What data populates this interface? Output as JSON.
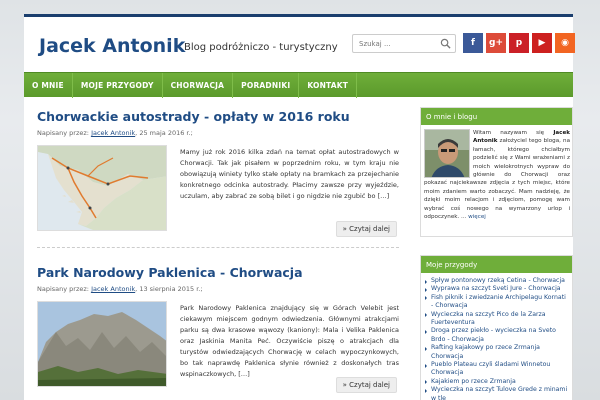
{
  "site": {
    "title": "Jacek Antonik",
    "description": "Blog podróżniczo - turystyczny"
  },
  "search": {
    "placeholder": "Szukaj ..."
  },
  "social": [
    {
      "name": "facebook-icon",
      "glyph": "f",
      "color": "#3b5998"
    },
    {
      "name": "google-plus-icon",
      "glyph": "g+",
      "color": "#dd4b39"
    },
    {
      "name": "pinterest-icon",
      "glyph": "p",
      "color": "#cb2027"
    },
    {
      "name": "youtube-icon",
      "glyph": "▶",
      "color": "#cd201f"
    },
    {
      "name": "rss-icon",
      "glyph": "◉",
      "color": "#f26522"
    }
  ],
  "nav": [
    "O MNIE",
    "MOJE PRZYGODY",
    "CHORWACJA",
    "PORADNIKI",
    "KONTAKT"
  ],
  "posts": [
    {
      "title": "Chorwackie autostrady - opłaty w 2016 roku",
      "meta_prefix": "Napisany przez:",
      "author": "Jacek Antonik",
      "date": "25 maja 2016 r.;",
      "excerpt": "Mamy już rok 2016 kilka zdań na temat opłat autostradowych w Chorwacji. Tak jak pisałem w poprzednim roku, w tym kraju nie obowiązują winiety tylko stałe opłaty na bramkach za przejechanie konkretnego odcinka autostrady. Płacimy zawsze przy wyjeździe, uczulam, aby zabrać ze sobą bilet i go nigdzie nie zgubić bo […]",
      "readmore": "» Czytaj dalej"
    },
    {
      "title": "Park Narodowy Paklenica - Chorwacja",
      "meta_prefix": "Napisany przez:",
      "author": "Jacek Antonik",
      "date": "13 sierpnia 2015 r.;",
      "excerpt": "Park Narodowy Paklenica znajdujący się w Górach Velebit jest ciekawym miejscem godnym odwiedzenia. Głównymi atrakcjami parku są dwa krasowe wąwozy (kaniony): Mala i Velika Paklenica oraz Jaskinia Manita Peć. Oczywiście piszę o atrakcjach dla turystów odwiedzających Chorwację w celach wypoczynkowych, bo tak naprawdę Paklenica słynie również z doskonałych tras wspinaczkowych, […]",
      "readmore": "» Czytaj dalej"
    }
  ],
  "sidebar": {
    "about_title": "O mnie i blogu",
    "about_lead": "Witam nazywam się",
    "about_name": "Jacek Antonik",
    "about_text": " założyciel tego bloga, na łamach, którego chciałbym podzielić się z Wami wrażeniami z moich wielokrotnych wypraw do głównie do Chorwacji oraz pokazać najciekawsze zdjęcia z tych miejsc, które moim zdaniem warto zobaczyć. Mam nadzieję, że dzięki moim relacjom i zdjęciom, pomogę wam wybrać coś nowego na wymarzony urlop i odpoczynek. ...",
    "about_more": "więcej",
    "trips_title": "Moje przygody",
    "trips": [
      "Spływ pontonowy rzeką Cetina - Chorwacja",
      "Wyprawa na szczyt Sveti Jure - Chorwacja",
      "Fish piknik i zwiedzanie Archipelagu Kornati - Chorwacja",
      "Wycieczka na szczyt Pico de la Zarza Fuerteventura",
      "Droga przez piekło - wycieczka na Sveto Brdo - Chorwacja",
      "Rafting kajakowy po rzece Zrmanja Chorwacja",
      "Pueblo Plateau czyli śladami Winnetou Chorwacja",
      "Kajakiem po rzece Zrmanja",
      "Wycieczka na szczyt Tulove Grede z minami w tle"
    ]
  }
}
